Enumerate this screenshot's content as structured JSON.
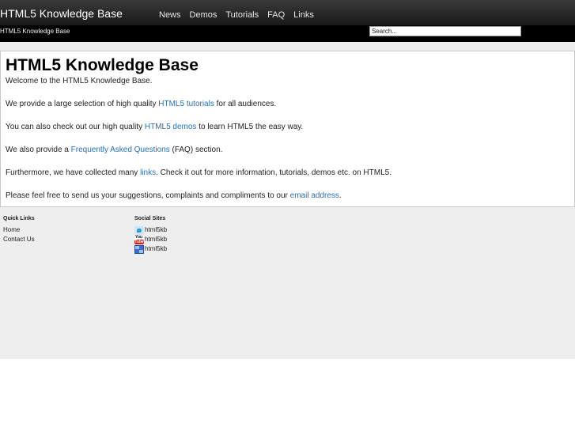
{
  "header": {
    "site_title": "HTML5 Knowledge Base",
    "nav": [
      "News",
      "Demos",
      "Tutorials",
      "FAQ",
      "Links"
    ],
    "tagline": "HTML5 Knowledge Base",
    "search_value": "Search..."
  },
  "content": {
    "heading": "HTML5 Knowledge Base",
    "welcome": "Welcome to the HTML5 Knowledge Base.",
    "p1": {
      "before": "We provide a large selection of high quality ",
      "link": "HTML5 tutorials",
      "after": " for all audiences."
    },
    "p2": {
      "before": "You can also check out our high quality ",
      "link": "HTML5 demos",
      "after": " to learn HTML5 the easy way."
    },
    "p3": {
      "before": "We also provide a ",
      "link": "Frequently Asked Questions",
      "after": " (FAQ) section."
    },
    "p4": {
      "before": "Furthermore, we have collected many ",
      "link": "links",
      "after": ". Check it out for more information, tutorials, demos etc. on HTML5."
    },
    "p5": {
      "before": "Please feel free to send us your suggestions, complaints and compliments to our ",
      "link": "email address",
      "after": "."
    }
  },
  "footer": {
    "quick_links": {
      "title": "Quick Links",
      "items": [
        "Home",
        "Contact Us"
      ]
    },
    "social": {
      "title": "Social Sites",
      "items": [
        {
          "icon": "twitter-icon",
          "label": "html5kb"
        },
        {
          "icon": "youtube-icon",
          "label": "html5kb",
          "icon_text_top": "You",
          "icon_text_bottom": "Tube"
        },
        {
          "icon": "delicious-icon",
          "label": "html5kb"
        }
      ]
    }
  }
}
